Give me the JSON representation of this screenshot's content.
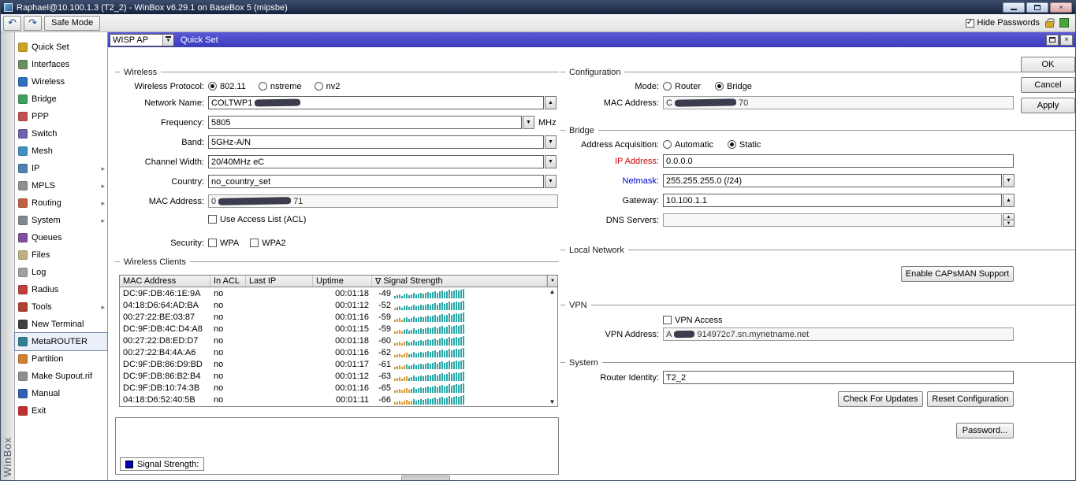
{
  "window": {
    "title": "Raphael@10.100.1.3 (T2_2) - WinBox v6.29.1 on BaseBox 5 (mipsbe)"
  },
  "toolbar": {
    "undo_icon": "undo-arrow",
    "redo_icon": "redo-arrow",
    "safe_mode_label": "Safe Mode",
    "hide_passwords_label": "Hide Passwords",
    "hide_passwords_checked": true
  },
  "brand": "WinBox",
  "sidebar": {
    "items": [
      {
        "label": "Quick Set",
        "icon": "quick-set-icon",
        "color": "#c9a227",
        "arrow": false
      },
      {
        "label": "Interfaces",
        "icon": "interfaces-icon",
        "color": "#6a8f5f",
        "arrow": false
      },
      {
        "label": "Wireless",
        "icon": "wireless-icon",
        "color": "#2f6fc0",
        "arrow": false
      },
      {
        "label": "Bridge",
        "icon": "bridge-icon",
        "color": "#3f9f5f",
        "arrow": false
      },
      {
        "label": "PPP",
        "icon": "ppp-icon",
        "color": "#c05050",
        "arrow": false
      },
      {
        "label": "Switch",
        "icon": "switch-icon",
        "color": "#7060b0",
        "arrow": false
      },
      {
        "label": "Mesh",
        "icon": "mesh-icon",
        "color": "#4090c0",
        "arrow": false
      },
      {
        "label": "IP",
        "icon": "ip-icon",
        "color": "#5080b0",
        "arrow": true
      },
      {
        "label": "MPLS",
        "icon": "mpls-icon",
        "color": "#909090",
        "arrow": true
      },
      {
        "label": "Routing",
        "icon": "routing-icon",
        "color": "#c06040",
        "arrow": true
      },
      {
        "label": "System",
        "icon": "system-gear-icon",
        "color": "#808890",
        "arrow": true
      },
      {
        "label": "Queues",
        "icon": "queues-icon",
        "color": "#8050a0",
        "arrow": false
      },
      {
        "label": "Files",
        "icon": "files-icon",
        "color": "#c0b080",
        "arrow": false
      },
      {
        "label": "Log",
        "icon": "log-icon",
        "color": "#a0a0a0",
        "arrow": false
      },
      {
        "label": "Radius",
        "icon": "radius-icon",
        "color": "#c04040",
        "arrow": false
      },
      {
        "label": "Tools",
        "icon": "tools-wrench-icon",
        "color": "#b04030",
        "arrow": true
      },
      {
        "label": "New Terminal",
        "icon": "terminal-icon",
        "color": "#404040",
        "arrow": false
      },
      {
        "label": "MetaROUTER",
        "icon": "metarouter-icon",
        "color": "#308090",
        "arrow": false,
        "selected": true
      },
      {
        "label": "Partition",
        "icon": "partition-icon",
        "color": "#d08030",
        "arrow": false
      },
      {
        "label": "Make Supout.rif",
        "icon": "supout-icon",
        "color": "#909090",
        "arrow": false
      },
      {
        "label": "Manual",
        "icon": "manual-book-icon",
        "color": "#3060b0",
        "arrow": false
      },
      {
        "label": "Exit",
        "icon": "exit-icon",
        "color": "#c03030",
        "arrow": false
      }
    ]
  },
  "quickset": {
    "mode_value": "WISP AP",
    "title": "Quick Set",
    "wireless": {
      "section": "Wireless",
      "protocol_label": "Wireless Protocol:",
      "protocol_options": [
        {
          "label": "802.11",
          "selected": true
        },
        {
          "label": "nstreme",
          "selected": false
        },
        {
          "label": "nv2",
          "selected": false
        }
      ],
      "network_name_label": "Network Name:",
      "network_name_value": "COLTWP1",
      "network_name_redacted": true,
      "frequency_label": "Frequency:",
      "frequency_value": "5805",
      "frequency_unit": "MHz",
      "band_label": "Band:",
      "band_value": "5GHz-A/N",
      "channel_width_label": "Channel Width:",
      "channel_width_value": "20/40MHz eC",
      "country_label": "Country:",
      "country_value": "no_country_set",
      "mac_label": "MAC Address:",
      "mac_prefix": "0",
      "mac_suffix": "71",
      "mac_redacted": true,
      "acl_label": "Use Access List (ACL)",
      "acl_checked": false,
      "security_label": "Security:",
      "wpa_label": "WPA",
      "wpa_checked": false,
      "wpa2_label": "WPA2",
      "wpa2_checked": false
    },
    "clients": {
      "section": "Wireless Clients",
      "columns": [
        "MAC Address",
        "In ACL",
        "Last IP",
        "Uptime",
        "Signal Strength"
      ],
      "sort_indicator": "∇",
      "rows": [
        {
          "mac": "DC:9F:DB:46:1E:9A",
          "in_acl": "no",
          "last_ip": "",
          "uptime": "00:01:18",
          "signal": "-49"
        },
        {
          "mac": "04:18:D6:64:AD:BA",
          "in_acl": "no",
          "last_ip": "",
          "uptime": "00:01:12",
          "signal": "-52"
        },
        {
          "mac": "00:27:22:BE:03:87",
          "in_acl": "no",
          "last_ip": "",
          "uptime": "00:01:16",
          "signal": "-59"
        },
        {
          "mac": "DC:9F:DB:4C:D4:A8",
          "in_acl": "no",
          "last_ip": "",
          "uptime": "00:01:15",
          "signal": "-59"
        },
        {
          "mac": "00:27:22:D8:ED:D7",
          "in_acl": "no",
          "last_ip": "",
          "uptime": "00:01:18",
          "signal": "-60"
        },
        {
          "mac": "00:27:22:B4:4A:A6",
          "in_acl": "no",
          "last_ip": "",
          "uptime": "00:01:16",
          "signal": "-62"
        },
        {
          "mac": "DC:9F:DB:86:D9:BD",
          "in_acl": "no",
          "last_ip": "",
          "uptime": "00:01:17",
          "signal": "-61"
        },
        {
          "mac": "DC:9F:DB:86:B2:B4",
          "in_acl": "no",
          "last_ip": "",
          "uptime": "00:01:12",
          "signal": "-63"
        },
        {
          "mac": "DC:9F:DB:10:74:3B",
          "in_acl": "no",
          "last_ip": "",
          "uptime": "00:01:16",
          "signal": "-65"
        },
        {
          "mac": "04:18:D6:52:40:5B",
          "in_acl": "no",
          "last_ip": "",
          "uptime": "00:01:11",
          "signal": "-66"
        }
      ]
    },
    "graph": {
      "legend_label": "Signal Strength:"
    }
  },
  "configuration": {
    "section": "Configuration",
    "mode_label": "Mode:",
    "mode_options": [
      {
        "label": "Router",
        "selected": false
      },
      {
        "label": "Bridge",
        "selected": true
      }
    ],
    "mac_label": "MAC Address:",
    "mac_prefix": "C",
    "mac_suffix": "70",
    "mac_redacted": true
  },
  "bridge": {
    "section": "Bridge",
    "acquisition_label": "Address Acquisition:",
    "acquisition_options": [
      {
        "label": "Automatic",
        "selected": false
      },
      {
        "label": "Static",
        "selected": true
      }
    ],
    "ip_label": "IP Address:",
    "ip_value": "0.0.0.0",
    "netmask_label": "Netmask:",
    "netmask_value": "255.255.255.0 (/24)",
    "gateway_label": "Gateway:",
    "gateway_value": "10.100.1.1",
    "dns_label": "DNS Servers:",
    "dns_value": ""
  },
  "local_network": {
    "section": "Local Network",
    "capsman_button": "Enable CAPsMAN Support"
  },
  "vpn": {
    "section": "VPN",
    "access_label": "VPN Access",
    "access_checked": false,
    "address_label": "VPN Address:",
    "address_prefix": "A",
    "address_suffix": "914972c7.sn.mynetname.net",
    "address_redacted": true
  },
  "system": {
    "section": "System",
    "identity_label": "Router Identity:",
    "identity_value": "T2_2",
    "check_updates_button": "Check For Updates",
    "reset_button": "Reset Configuration",
    "password_button": "Password..."
  },
  "actions": {
    "ok": "OK",
    "cancel": "Cancel",
    "apply": "Apply"
  },
  "colors": {
    "qs_titlebar": "#3b3bbc",
    "ip_label": "#cc0000",
    "netmask_label": "#0000cc",
    "signal_bar": "#2aa8a8",
    "signal_bar_warn": "#d89a30",
    "legend_swatch": "#0000bb"
  }
}
